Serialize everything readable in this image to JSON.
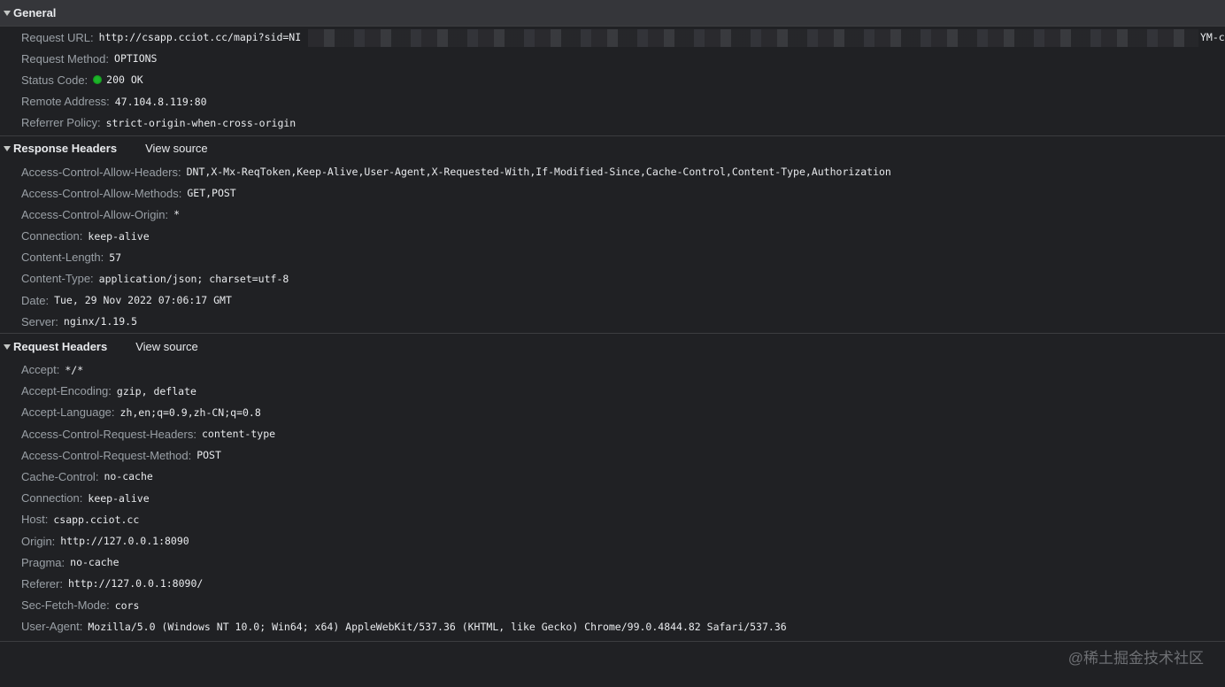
{
  "general": {
    "title": "General",
    "rows": [
      {
        "key": "Request URL:",
        "value": "http://csapp.cciot.cc/mapi?sid=NI"
      },
      {
        "key": "Request Method:",
        "value": "OPTIONS"
      },
      {
        "key": "Status Code:",
        "value": "200 OK"
      },
      {
        "key": "Remote Address:",
        "value": "47.104.8.119:80"
      },
      {
        "key": "Referrer Policy:",
        "value": "strict-origin-when-cross-origin"
      }
    ],
    "url_tail": "YM-c",
    "status_color": "#1db62a"
  },
  "response_headers": {
    "title": "Response Headers",
    "view_source": "View source",
    "rows": [
      {
        "key": "Access-Control-Allow-Headers:",
        "value": "DNT,X-Mx-ReqToken,Keep-Alive,User-Agent,X-Requested-With,If-Modified-Since,Cache-Control,Content-Type,Authorization"
      },
      {
        "key": "Access-Control-Allow-Methods:",
        "value": "GET,POST"
      },
      {
        "key": "Access-Control-Allow-Origin:",
        "value": "*"
      },
      {
        "key": "Connection:",
        "value": "keep-alive"
      },
      {
        "key": "Content-Length:",
        "value": "57"
      },
      {
        "key": "Content-Type:",
        "value": "application/json; charset=utf-8"
      },
      {
        "key": "Date:",
        "value": "Tue, 29 Nov 2022 07:06:17 GMT"
      },
      {
        "key": "Server:",
        "value": "nginx/1.19.5"
      }
    ]
  },
  "request_headers": {
    "title": "Request Headers",
    "view_source": "View source",
    "rows": [
      {
        "key": "Accept:",
        "value": "*/*"
      },
      {
        "key": "Accept-Encoding:",
        "value": "gzip, deflate"
      },
      {
        "key": "Accept-Language:",
        "value": "zh,en;q=0.9,zh-CN;q=0.8"
      },
      {
        "key": "Access-Control-Request-Headers:",
        "value": "content-type"
      },
      {
        "key": "Access-Control-Request-Method:",
        "value": "POST"
      },
      {
        "key": "Cache-Control:",
        "value": "no-cache"
      },
      {
        "key": "Connection:",
        "value": "keep-alive"
      },
      {
        "key": "Host:",
        "value": "csapp.cciot.cc"
      },
      {
        "key": "Origin:",
        "value": "http://127.0.0.1:8090"
      },
      {
        "key": "Pragma:",
        "value": "no-cache"
      },
      {
        "key": "Referer:",
        "value": "http://127.0.0.1:8090/"
      },
      {
        "key": "Sec-Fetch-Mode:",
        "value": "cors"
      },
      {
        "key": "User-Agent:",
        "value": "Mozilla/5.0 (Windows NT 10.0; Win64; x64) AppleWebKit/537.36 (KHTML, like Gecko) Chrome/99.0.4844.82 Safari/537.36"
      }
    ]
  },
  "watermark": "@稀土掘金技术社区"
}
